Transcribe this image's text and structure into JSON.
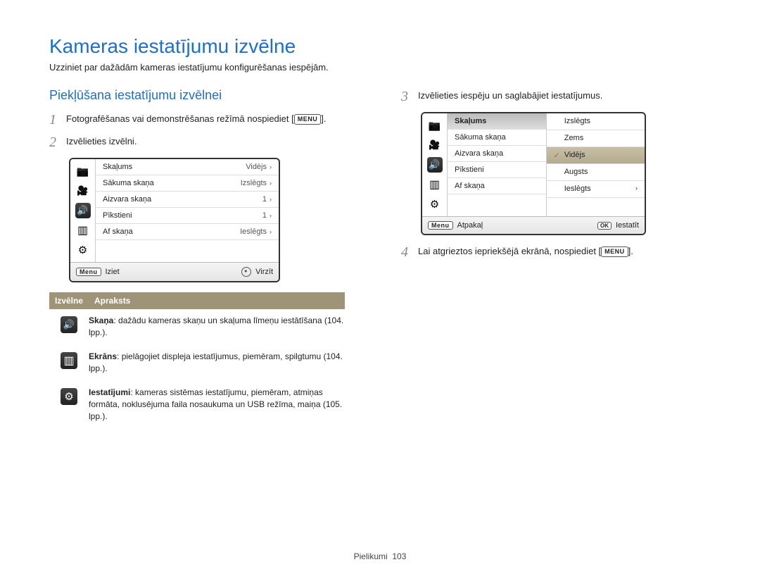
{
  "page": {
    "title": "Kameras iestatījumu izvēlne",
    "subtitle": "Uzziniet par dažādām kameras iestatījumu konfigurēšanas iespējām.",
    "footer_label": "Pielikumi",
    "footer_page": "103"
  },
  "left": {
    "section_title": "Piekļūšana iestatījumu izvēlnei",
    "step1_a": "Fotografēšanas vai demonstrēšanas režīmā nospiediet [",
    "step1_menu": "MENU",
    "step1_b": "].",
    "step2": "Izvēlieties izvēlni.",
    "screen": {
      "rows": [
        {
          "label": "Skaļums",
          "value": "Vidējs"
        },
        {
          "label": "Sākuma skaņa",
          "value": "Izslēgts"
        },
        {
          "label": "Aizvara skaņa",
          "value": "1"
        },
        {
          "label": "Pīkstieni",
          "value": "1"
        },
        {
          "label": "Af skaņa",
          "value": "Ieslēgts"
        }
      ],
      "footer_left_btn": "Menu",
      "footer_left": "Iziet",
      "footer_right": "Virzīt"
    },
    "desc": {
      "head_icon": "Izvēlne",
      "head_text": "Apraksts",
      "rows": [
        {
          "icon": "speaker",
          "bold": "Skaņa",
          "text": ": dažādu kameras skaņu un skaļuma līmeņu iestātīšana (104. lpp.)."
        },
        {
          "icon": "screen",
          "bold": "Ekrāns",
          "text": ": pielāgojiet displeja iestatījumus, piemēram, spilgtumu (104. lpp.)."
        },
        {
          "icon": "gear",
          "bold": "Iestatījumi",
          "text": ": kameras sistēmas iestatījumu, piemēram, atmiņas formāta, noklusējuma faila nosaukuma un USB režīma, maiņa (105. lpp.)."
        }
      ]
    }
  },
  "right": {
    "step3": "Izvēlieties iespēju un saglabājiet iestatījumus.",
    "screen": {
      "left_rows": [
        {
          "label": "Skaļums",
          "hl": true
        },
        {
          "label": "Sākuma skaņa",
          "hl": false
        },
        {
          "label": "Aizvara skaņa",
          "hl": false
        },
        {
          "label": "Pīkstieni",
          "hl": false
        },
        {
          "label": "Af skaņa",
          "hl": false
        }
      ],
      "right_rows": [
        {
          "label": "Izslēgts",
          "sel": false,
          "check": false
        },
        {
          "label": "Zems",
          "sel": false,
          "check": false
        },
        {
          "label": "Vidējs",
          "sel": true,
          "check": true
        },
        {
          "label": "Augsts",
          "sel": false,
          "check": false
        },
        {
          "label": "Ieslēgts",
          "sel": false,
          "check": false,
          "chev": true
        }
      ],
      "footer_left_btn": "Menu",
      "footer_left": "Atpakaļ",
      "footer_right_btn": "OK",
      "footer_right": "Iestatīt"
    },
    "step4_a": "Lai atgrieztos iepriekšējā ekrānā, nospiediet [",
    "step4_menu": "MENU",
    "step4_b": "]."
  }
}
